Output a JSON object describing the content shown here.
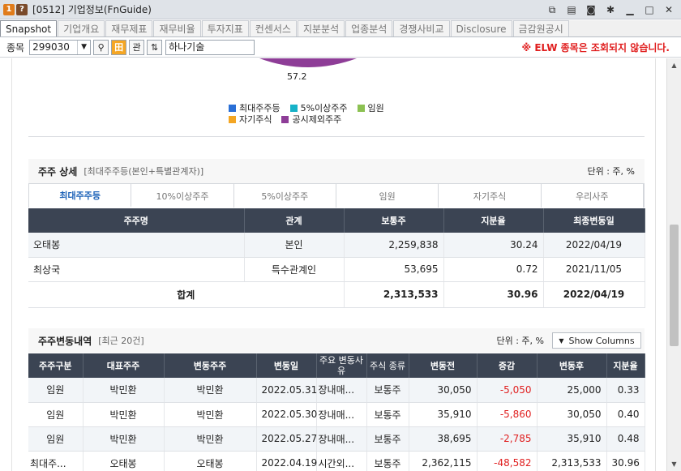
{
  "window": {
    "title": "[0512] 기업정보(FnGuide)",
    "icon1": "1",
    "icon2": "?"
  },
  "tabs": [
    "Snapshot",
    "기업개요",
    "재무제표",
    "재무비율",
    "투자지표",
    "컨센서스",
    "지분분석",
    "업종분석",
    "경쟁사비교",
    "Disclosure",
    "금감원공시"
  ],
  "toolbar": {
    "label": "종목",
    "code": "299030",
    "btn_kwan": "관",
    "name": "하나기술",
    "warning": "※ ELW 종목은 조회되지 않습니다."
  },
  "chart": {
    "value_label": "57.2"
  },
  "legend": [
    {
      "label": "최대주주등",
      "color": "#2a6fd6"
    },
    {
      "label": "5%이상주주",
      "color": "#17b2c8"
    },
    {
      "label": "임원",
      "color": "#8cc152"
    },
    {
      "label": "자기주식",
      "color": "#f4a623"
    },
    {
      "label": "공시제외주주",
      "color": "#8e3d97"
    }
  ],
  "holders": {
    "title": "주주 상세",
    "subtitle": "[최대주주등(본인+특별관계자)]",
    "unit": "단위 : 주, %",
    "tabs": [
      "최대주주등",
      "10%이상주주",
      "5%이상주주",
      "임원",
      "자기주식",
      "우리사주"
    ],
    "headers": [
      "주주명",
      "관계",
      "보통주",
      "지분율",
      "최종변동일"
    ],
    "rows": [
      [
        "오태봉",
        "본인",
        "2,259,838",
        "30.24",
        "2022/04/19"
      ],
      [
        "최상국",
        "특수관계인",
        "53,695",
        "0.72",
        "2021/11/05"
      ]
    ],
    "total": [
      "합계",
      "2,313,533",
      "30.96",
      "2022/04/19"
    ]
  },
  "changes": {
    "title": "주주변동내역",
    "subtitle": "[최근 20건]",
    "unit": "단위 : 주, %",
    "show_columns": "Show Columns",
    "headers": [
      "주주구분",
      "대표주주",
      "변동주주",
      "변동일",
      "주요 변동사유",
      "주식 종류",
      "변동전",
      "증감",
      "변동후",
      "지분율"
    ],
    "rows": [
      [
        "임원",
        "박민환",
        "박민환",
        "2022.05.31",
        "장내매...",
        "보통주",
        "30,050",
        "-5,050",
        "25,000",
        "0.33"
      ],
      [
        "임원",
        "박민환",
        "박민환",
        "2022.05.30",
        "장내매...",
        "보통주",
        "35,910",
        "-5,860",
        "30,050",
        "0.40"
      ],
      [
        "임원",
        "박민환",
        "박민환",
        "2022.05.27",
        "장내매...",
        "보통주",
        "38,695",
        "-2,785",
        "35,910",
        "0.48"
      ],
      [
        "최대주...",
        "오태봉",
        "오태봉",
        "2022.04.19",
        "시간외...",
        "보통주",
        "2,362,115",
        "-48,582",
        "2,313,533",
        "30.96"
      ]
    ]
  }
}
